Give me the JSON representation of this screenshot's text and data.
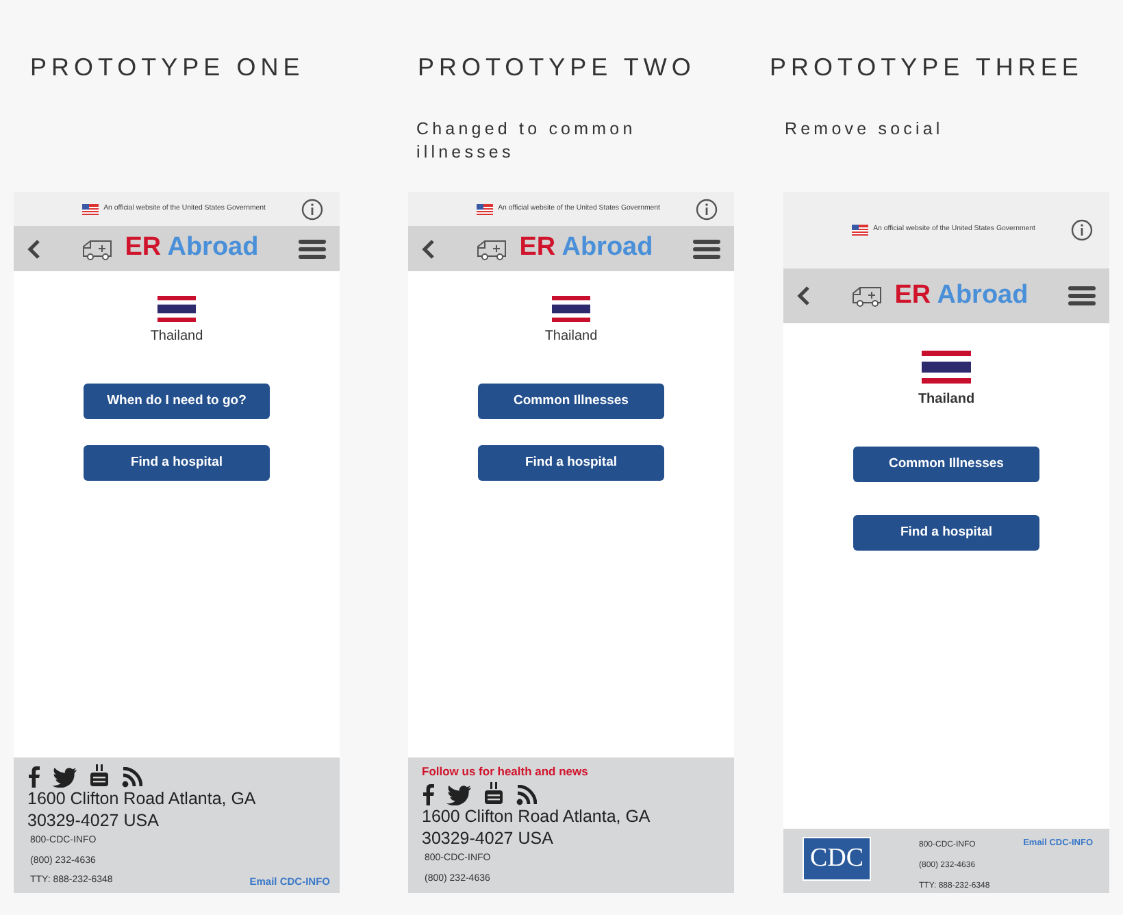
{
  "prototypes": [
    {
      "kind": "standard",
      "title": "PROTOTYPE ONE",
      "gov_banner": "An official website of the United States Government",
      "brand": [
        "ER",
        "Abroad"
      ],
      "country": "Thailand",
      "buttons": [
        "When do I need to go?",
        "Find a hospital"
      ],
      "footer": {
        "kind": "social",
        "address": [
          "1600 Clifton Road Atlanta, GA",
          "30329-4027 USA"
        ],
        "contacts": [
          "800-CDC-INFO",
          "(800) 232-4636",
          "TTY: 888-232-6348"
        ],
        "email_link": "Email CDC-INFO"
      }
    },
    {
      "kind": "standard",
      "title": "PROTOTYPE TWO",
      "subtitle": "Changed to common illnesses",
      "gov_banner": "An official website of the United States Government",
      "brand": [
        "ER",
        "Abroad"
      ],
      "country": "Thailand",
      "buttons": [
        "Common Illnesses",
        "Find a hospital"
      ],
      "footer": {
        "kind": "social",
        "follow_text": "Follow us for health and news",
        "address": [
          "1600 Clifton Road Atlanta, GA",
          "30329-4027 USA"
        ],
        "contacts": [
          "800-CDC-INFO",
          "(800) 232-4636"
        ]
      }
    },
    {
      "kind": "enlarged",
      "title": "PROTOTYPE THREE",
      "subtitle": "Remove social",
      "gov_banner": "An official website of the United States Government",
      "brand": [
        "ER",
        "Abroad"
      ],
      "country": "Thailand",
      "buttons": [
        "Common Illnesses",
        "Find a hospital"
      ],
      "footer": {
        "kind": "logo",
        "logo_text": "CDC",
        "contacts": [
          "800-CDC-INFO",
          "(800) 232-4636",
          "TTY: 888-232-6348"
        ],
        "email_link": "Email CDC-INFO"
      }
    }
  ]
}
